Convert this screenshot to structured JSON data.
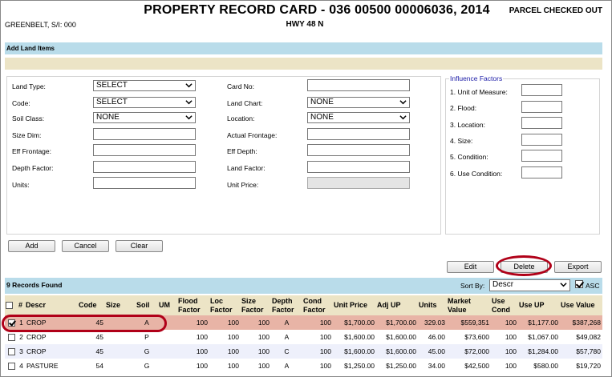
{
  "header": {
    "title": "PROPERTY RECORD CARD - 036 00500 00006036, 2014",
    "status": "PARCEL CHECKED OUT",
    "location": "GREENBELT, S/I: 000",
    "road": "HWY 48 N"
  },
  "section_title": "Add Land Items",
  "form": {
    "land_type": {
      "label": "Land Type:",
      "value": "SELECT"
    },
    "code": {
      "label": "Code:",
      "value": "SELECT"
    },
    "soil_class": {
      "label": "Soil Class:",
      "value": "NONE"
    },
    "size_dim": {
      "label": "Size Dim:",
      "value": ""
    },
    "eff_frontage": {
      "label": "Eff Frontage:",
      "value": ""
    },
    "depth_factor": {
      "label": "Depth Factor:",
      "value": ""
    },
    "units": {
      "label": "Units:",
      "value": ""
    },
    "card_no": {
      "label": "Card No:",
      "value": ""
    },
    "land_chart": {
      "label": "Land Chart:",
      "value": "NONE"
    },
    "location": {
      "label": "Location:",
      "value": "NONE"
    },
    "actual_frontage": {
      "label": "Actual Frontage:",
      "value": ""
    },
    "eff_depth": {
      "label": "Eff Depth:",
      "value": ""
    },
    "land_factor": {
      "label": "Land Factor:",
      "value": ""
    },
    "unit_price": {
      "label": "Unit Price:",
      "value": ""
    }
  },
  "influence": {
    "title": "Influence Factors",
    "items": [
      {
        "label": "1. Unit of Measure:",
        "value": ""
      },
      {
        "label": "2. Flood:",
        "value": ""
      },
      {
        "label": "3. Location:",
        "value": ""
      },
      {
        "label": "4. Size:",
        "value": ""
      },
      {
        "label": "5. Condition:",
        "value": ""
      },
      {
        "label": "6. Use Condition:",
        "value": ""
      }
    ]
  },
  "buttons": {
    "add": "Add",
    "cancel": "Cancel",
    "clear": "Clear",
    "edit": "Edit",
    "delete": "Delete",
    "export": "Export"
  },
  "records": {
    "count_label": "9 Records Found",
    "sort_label": "Sort By:",
    "sort_value": "Descr",
    "asc_label": "ASC",
    "asc_checked": true
  },
  "table": {
    "headers": [
      "",
      "#",
      "Descr",
      "Code",
      "Size",
      "Soil",
      "UM",
      "Flood Factor",
      "Loc Factor",
      "Size Factor",
      "Depth Factor",
      "Cond Factor",
      "Unit Price",
      "Adj UP",
      "Units",
      "Market Value",
      "Use Cond",
      "Use UP",
      "Use Value"
    ],
    "rows": [
      {
        "checked": true,
        "num": "1",
        "descr": "CROP",
        "code": "45",
        "size": "",
        "soil": "A",
        "um": "",
        "flood": "100",
        "loc": "100",
        "sizef": "100",
        "depth": "A",
        "cond": "100",
        "unit_price": "$1,700.00",
        "adj_up": "$1,700.00",
        "units": "329.03",
        "market": "$559,351",
        "use_cond": "100",
        "use_up": "$1,177.00",
        "use_value": "$387,268"
      },
      {
        "checked": false,
        "num": "2",
        "descr": "CROP",
        "code": "45",
        "size": "",
        "soil": "P",
        "um": "",
        "flood": "100",
        "loc": "100",
        "sizef": "100",
        "depth": "A",
        "cond": "100",
        "unit_price": "$1,600.00",
        "adj_up": "$1,600.00",
        "units": "46.00",
        "market": "$73,600",
        "use_cond": "100",
        "use_up": "$1,067.00",
        "use_value": "$49,082"
      },
      {
        "checked": false,
        "num": "3",
        "descr": "CROP",
        "code": "45",
        "size": "",
        "soil": "G",
        "um": "",
        "flood": "100",
        "loc": "100",
        "sizef": "100",
        "depth": "C",
        "cond": "100",
        "unit_price": "$1,600.00",
        "adj_up": "$1,600.00",
        "units": "45.00",
        "market": "$72,000",
        "use_cond": "100",
        "use_up": "$1,284.00",
        "use_value": "$57,780"
      },
      {
        "checked": false,
        "num": "4",
        "descr": "PASTURE",
        "code": "54",
        "size": "",
        "soil": "G",
        "um": "",
        "flood": "100",
        "loc": "100",
        "sizef": "100",
        "depth": "A",
        "cond": "100",
        "unit_price": "$1,250.00",
        "adj_up": "$1,250.00",
        "units": "34.00",
        "market": "$42,500",
        "use_cond": "100",
        "use_up": "$580.00",
        "use_value": "$19,720"
      }
    ]
  },
  "colors": {
    "highlight_ring": "#b00018",
    "blue_band": "#b9dcea",
    "tan_band": "#ece4c6",
    "selected_row": "#e8b4a6",
    "alt_row": "#eef0fb"
  }
}
